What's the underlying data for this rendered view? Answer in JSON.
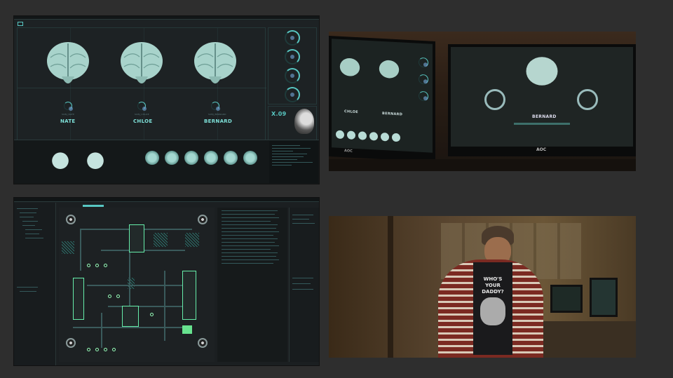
{
  "panel1": {
    "subjects": [
      {
        "name": "NATE",
        "tag": "SUBJ_NATE"
      },
      {
        "name": "CHLOE",
        "tag": "SUBJ_CHLOE"
      },
      {
        "name": "BERNARD",
        "tag": "SUBJ_BERNARD"
      }
    ],
    "readout": "X.09"
  },
  "panel2": {
    "left_monitor": {
      "brand": "AOC",
      "subjects": [
        "CHLOE",
        "BERNARD"
      ]
    },
    "right_monitor": {
      "brand": "AOC",
      "subject": "BERNARD"
    }
  },
  "panel4": {
    "shirt_text": "WHO'S YOUR DADDY?"
  },
  "colors": {
    "accent": "#58c7c2",
    "label": "#7ee0d8",
    "bg_dark": "#1d2224",
    "page_bg": "#2e2e2e"
  }
}
